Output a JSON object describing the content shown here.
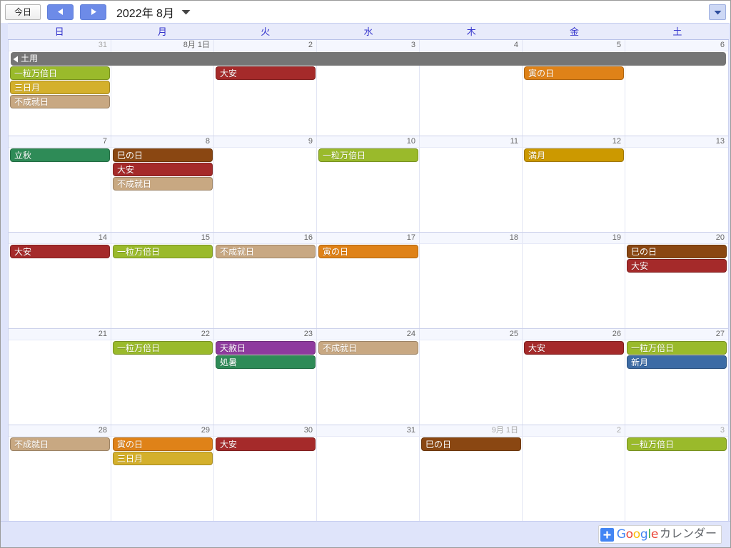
{
  "toolbar": {
    "today_label": "今日",
    "prev_label": "前へ",
    "next_label": "次へ",
    "title": "2022年 8月",
    "title_caret_icon": "chevron-down-icon",
    "view_dropdown_icon": "chevron-down-icon"
  },
  "weekdays": [
    "日",
    "月",
    "火",
    "水",
    "木",
    "金",
    "土"
  ],
  "colors": {
    "accent_blue": "#6d8be8",
    "weekday_text": "#3535cc",
    "banner_gray": "#757575",
    "footer_bg": "#dfe4fa",
    "chip_green_olive": "#9aba2b",
    "chip_gold": "#d4b02c",
    "chip_tan": "#c8a882",
    "chip_dark_red": "#a52a2a",
    "chip_orange": "#df8218",
    "chip_brown": "#8a4712",
    "chip_emerald": "#2e8b57",
    "chip_amber": "#cc9900",
    "chip_purple": "#8e3a9e",
    "chip_blue": "#3c6ba5"
  },
  "weeks": [
    {
      "banner": {
        "label": "土用",
        "continues_left": true,
        "color": "#757575"
      },
      "days": [
        {
          "num": "31",
          "other_month": true,
          "events": [
            {
              "label": "一粒万倍日",
              "color": "#9aba2b"
            },
            {
              "label": "三日月",
              "color": "#d4b02c"
            },
            {
              "label": "不成就日",
              "color": "#c8a882"
            }
          ]
        },
        {
          "num": "8月 1日",
          "other_month": false,
          "events": []
        },
        {
          "num": "2",
          "other_month": false,
          "events": [
            {
              "label": "大安",
              "color": "#a52a2a"
            }
          ]
        },
        {
          "num": "3",
          "other_month": false,
          "events": []
        },
        {
          "num": "4",
          "other_month": false,
          "events": []
        },
        {
          "num": "5",
          "other_month": false,
          "events": [
            {
              "label": "寅の日",
              "color": "#df8218"
            }
          ]
        },
        {
          "num": "6",
          "other_month": false,
          "events": []
        }
      ]
    },
    {
      "banner": null,
      "days": [
        {
          "num": "7",
          "other_month": false,
          "events": [
            {
              "label": "立秋",
              "color": "#2e8b57"
            }
          ]
        },
        {
          "num": "8",
          "other_month": false,
          "events": [
            {
              "label": "巳の日",
              "color": "#8a4712"
            },
            {
              "label": "大安",
              "color": "#a52a2a"
            },
            {
              "label": "不成就日",
              "color": "#c8a882"
            }
          ]
        },
        {
          "num": "9",
          "other_month": false,
          "events": []
        },
        {
          "num": "10",
          "other_month": false,
          "events": [
            {
              "label": "一粒万倍日",
              "color": "#9aba2b"
            }
          ]
        },
        {
          "num": "11",
          "other_month": false,
          "events": []
        },
        {
          "num": "12",
          "other_month": false,
          "events": [
            {
              "label": "満月",
              "color": "#cc9900"
            }
          ]
        },
        {
          "num": "13",
          "other_month": false,
          "events": []
        }
      ]
    },
    {
      "banner": null,
      "days": [
        {
          "num": "14",
          "other_month": false,
          "events": [
            {
              "label": "大安",
              "color": "#a52a2a"
            }
          ]
        },
        {
          "num": "15",
          "other_month": false,
          "events": [
            {
              "label": "一粒万倍日",
              "color": "#9aba2b"
            }
          ]
        },
        {
          "num": "16",
          "other_month": false,
          "events": [
            {
              "label": "不成就日",
              "color": "#c8a882"
            }
          ]
        },
        {
          "num": "17",
          "other_month": false,
          "events": [
            {
              "label": "寅の日",
              "color": "#df8218"
            }
          ]
        },
        {
          "num": "18",
          "other_month": false,
          "events": []
        },
        {
          "num": "19",
          "other_month": false,
          "events": []
        },
        {
          "num": "20",
          "other_month": false,
          "events": [
            {
              "label": "巳の日",
              "color": "#8a4712"
            },
            {
              "label": "大安",
              "color": "#a52a2a"
            }
          ]
        }
      ]
    },
    {
      "banner": null,
      "days": [
        {
          "num": "21",
          "other_month": false,
          "events": []
        },
        {
          "num": "22",
          "other_month": false,
          "events": [
            {
              "label": "一粒万倍日",
              "color": "#9aba2b"
            }
          ]
        },
        {
          "num": "23",
          "other_month": false,
          "events": [
            {
              "label": "天赦日",
              "color": "#8e3a9e"
            },
            {
              "label": "処暑",
              "color": "#2e8b57"
            }
          ]
        },
        {
          "num": "24",
          "other_month": false,
          "events": [
            {
              "label": "不成就日",
              "color": "#c8a882"
            }
          ]
        },
        {
          "num": "25",
          "other_month": false,
          "events": []
        },
        {
          "num": "26",
          "other_month": false,
          "events": [
            {
              "label": "大安",
              "color": "#a52a2a"
            }
          ]
        },
        {
          "num": "27",
          "other_month": false,
          "events": [
            {
              "label": "一粒万倍日",
              "color": "#9aba2b"
            },
            {
              "label": "新月",
              "color": "#3c6ba5"
            }
          ]
        }
      ]
    },
    {
      "banner": null,
      "days": [
        {
          "num": "28",
          "other_month": false,
          "events": [
            {
              "label": "不成就日",
              "color": "#c8a882"
            }
          ]
        },
        {
          "num": "29",
          "other_month": false,
          "events": [
            {
              "label": "寅の日",
              "color": "#df8218"
            },
            {
              "label": "三日月",
              "color": "#d4b02c"
            }
          ]
        },
        {
          "num": "30",
          "other_month": false,
          "events": [
            {
              "label": "大安",
              "color": "#a52a2a"
            }
          ]
        },
        {
          "num": "31",
          "other_month": false,
          "events": []
        },
        {
          "num": "9月 1日",
          "other_month": true,
          "events": [
            {
              "label": "巳の日",
              "color": "#8a4712"
            }
          ]
        },
        {
          "num": "2",
          "other_month": true,
          "events": []
        },
        {
          "num": "3",
          "other_month": true,
          "events": [
            {
              "label": "一粒万倍日",
              "color": "#9aba2b"
            }
          ]
        }
      ]
    }
  ],
  "footer": {
    "plus_icon": "plus-icon",
    "logo_letters": [
      {
        "ch": "G",
        "cls": "g-b"
      },
      {
        "ch": "o",
        "cls": "g-r"
      },
      {
        "ch": "o",
        "cls": "g-y"
      },
      {
        "ch": "g",
        "cls": "g-b"
      },
      {
        "ch": "l",
        "cls": "g-g"
      },
      {
        "ch": "e",
        "cls": "g-r"
      }
    ],
    "word": "カレンダー"
  }
}
